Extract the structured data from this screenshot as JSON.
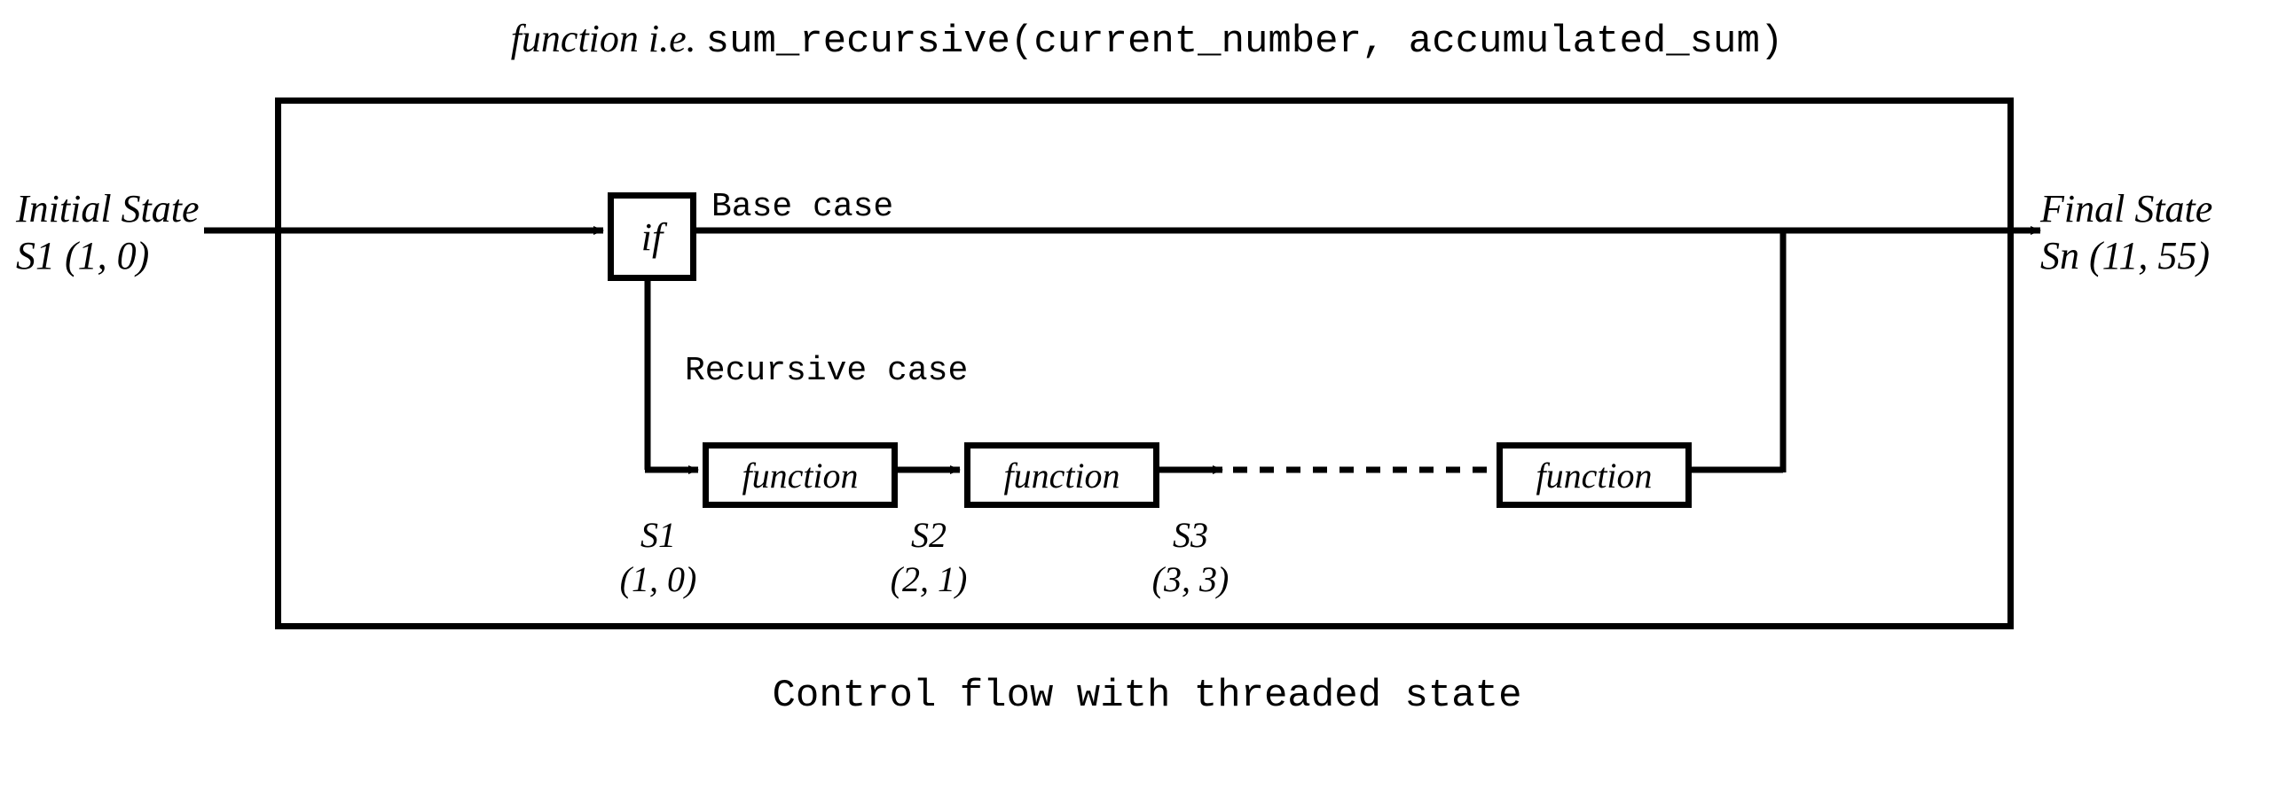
{
  "title": {
    "lead": "function i.e.",
    "code": "sum_recursive(current_number, accumulated_sum)"
  },
  "initial": {
    "line1": "Initial State",
    "line2": "S1 (1, 0)"
  },
  "final": {
    "line1": "Final State",
    "line2": "Sn (11, 55)"
  },
  "if_label": "if",
  "base_case": "Base case",
  "recursive_case": "Recursive case",
  "fn_label": "function",
  "states": {
    "s1": {
      "name": "S1",
      "val": "(1, 0)"
    },
    "s2": {
      "name": "S2",
      "val": "(2, 1)"
    },
    "s3": {
      "name": "S3",
      "val": "(3, 3)"
    }
  },
  "caption": "Control flow with threaded state"
}
